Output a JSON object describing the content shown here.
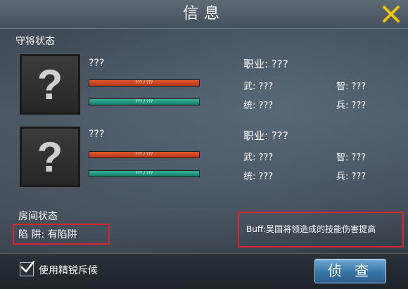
{
  "header": {
    "title": "信息",
    "close_icon": "close-icon",
    "accent_color": "#f0c400"
  },
  "generals_section": {
    "label": "守将状态",
    "generals": [
      {
        "name": "???",
        "hp_text": "??? / ???",
        "troop_text": "??? / ???",
        "job": "职业: ???",
        "wu": "武: ???",
        "zhi": "智: ???",
        "tong": "统: ???",
        "bing": "兵: ???"
      },
      {
        "name": "???",
        "hp_text": "??? / ???",
        "troop_text": "??? / ???",
        "job": "职业: ???",
        "wu": "武: ???",
        "zhi": "智: ???",
        "tong": "统: ???",
        "bing": "兵: ???"
      }
    ]
  },
  "room_section": {
    "label": "房间状态",
    "trap": "陷 阱:  有陷阱",
    "buff": "Buff:吴国将领造成的技能伤害提高"
  },
  "footer": {
    "checkbox_label": "使用精锐斥候",
    "checkbox_checked": true,
    "scout_button": "侦 查"
  }
}
